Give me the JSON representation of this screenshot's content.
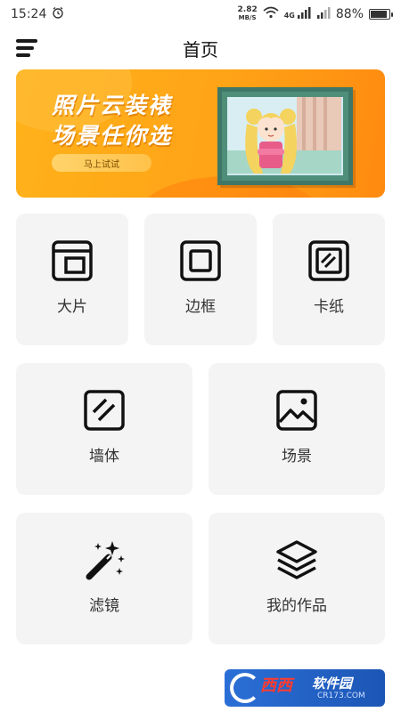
{
  "status_bar": {
    "time": "15:24",
    "net_speed_value": "2.82",
    "net_speed_unit": "MB/S",
    "network_type": "4G",
    "battery": "88%",
    "battery_level": 0.88
  },
  "header": {
    "title": "首页"
  },
  "banner": {
    "line1": "照片云装裱",
    "line2": "场景任你选",
    "button_label": "马上试试"
  },
  "tools": [
    {
      "label": "大片",
      "icon": "photo-frame-icon"
    },
    {
      "label": "边框",
      "icon": "square-border-icon"
    },
    {
      "label": "卡纸",
      "icon": "cardboard-icon"
    },
    {
      "label": "墙体",
      "icon": "wall-icon"
    },
    {
      "label": "场景",
      "icon": "scene-image-icon"
    },
    {
      "label": "滤镜",
      "icon": "magic-wand-icon"
    },
    {
      "label": "我的作品",
      "icon": "layers-icon"
    }
  ],
  "watermark": {
    "main": "西西",
    "sub": "软件园",
    "domain": "CR173.COM"
  }
}
